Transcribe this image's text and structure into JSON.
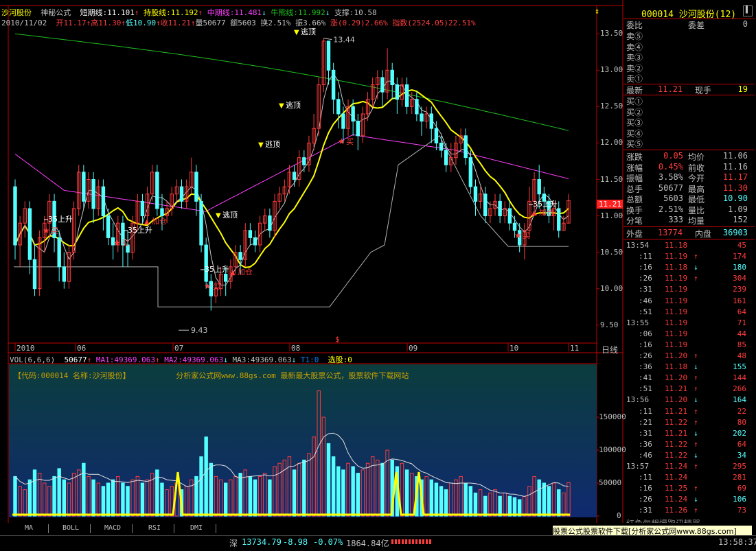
{
  "colors": {
    "up": "#ff3c3c",
    "down": "#54ffff",
    "yellow": "#ffff00",
    "magenta": "#ff40ff",
    "green": "#20c020",
    "white": "#c8c8c8",
    "orange": "#ff8c1a"
  },
  "header": {
    "stock_name": "沙河股份",
    "formula": "神秘公式",
    "short_label": "短期线:11.101",
    "hold_label": "持股线:11.192",
    "mid_label": "中期线:11.481",
    "bull_label": "牛熊线:11.992",
    "support_label": "支撑:10.58",
    "date": "2010/11/02",
    "open": "开11.17",
    "high": "高11.30",
    "low": "低10.90",
    "close": "收11.21",
    "vol": "量50677",
    "amt": "额5603",
    "turnover": "换2.51%",
    "swing": "振3.66%",
    "change": "涨(0.29)2.66%",
    "index": "指数(2524.05)22.51%"
  },
  "price_axis": [
    "13.50",
    "13.00",
    "12.50",
    "12.00",
    "11.50",
    "11.00",
    "10.50",
    "10.00",
    "9.50"
  ],
  "current_price_tag": "11.21",
  "time_axis": [
    "2010",
    "06",
    "07",
    "08",
    "09",
    "10",
    "11"
  ],
  "time_axis_right": "日线",
  "annotations": {
    "max": "13.44",
    "min": "9.43",
    "buy": "买",
    "escape": "逃顶",
    "add": "加仓",
    "up35": "35上升",
    "dollar": "$"
  },
  "vol_header": {
    "title": "VOL(6,6,6)",
    "v": "50677",
    "ma1": "MA1:49369.063",
    "ma2": "MA2:49369.063",
    "ma3": "MA3:49369.063",
    "t1": "T1:0",
    "xuan": "选股:0"
  },
  "vol_banner": {
    "code": "【代码:000014 名称:沙河股份】",
    "site": "分析家公式网www.88gs.com 最新最大股票公式，股票软件下载网站"
  },
  "vol_axis": [
    "150000",
    "100000",
    "50000",
    "0"
  ],
  "chart_data": {
    "type": "candlestick",
    "ylim": [
      9.3,
      13.7
    ],
    "candles": [
      [
        11.4,
        10.6,
        11.5,
        10.4
      ],
      [
        10.6,
        10.9,
        11.0,
        10.3
      ],
      [
        10.9,
        11.1,
        11.2,
        10.7
      ],
      [
        11.1,
        10.4,
        11.2,
        10.2
      ],
      [
        10.4,
        10.0,
        10.6,
        9.9
      ],
      [
        10.0,
        10.7,
        10.8,
        9.9
      ],
      [
        10.7,
        10.9,
        11.0,
        10.5
      ],
      [
        10.9,
        11.2,
        11.3,
        10.7
      ],
      [
        11.2,
        10.7,
        11.3,
        10.5
      ],
      [
        10.7,
        10.3,
        10.8,
        10.1
      ],
      [
        10.3,
        10.1,
        10.5,
        10.0
      ],
      [
        10.1,
        10.5,
        10.6,
        10.0
      ],
      [
        10.5,
        11.1,
        11.2,
        10.4
      ],
      [
        11.1,
        11.6,
        11.7,
        11.0
      ],
      [
        11.6,
        11.2,
        11.7,
        11.1
      ],
      [
        11.2,
        11.5,
        11.6,
        11.1
      ],
      [
        11.5,
        11.1,
        11.6,
        10.9
      ],
      [
        11.1,
        11.4,
        11.5,
        11.0
      ],
      [
        11.4,
        11.0,
        11.5,
        10.8
      ],
      [
        11.0,
        10.7,
        11.1,
        10.6
      ],
      [
        10.7,
        10.6,
        10.9,
        10.4
      ],
      [
        10.6,
        10.9,
        11.0,
        10.5
      ],
      [
        10.9,
        10.6,
        11.0,
        10.3
      ],
      [
        10.6,
        10.5,
        10.8,
        10.3
      ],
      [
        10.5,
        10.9,
        11.0,
        10.4
      ],
      [
        10.9,
        11.2,
        11.3,
        10.8
      ],
      [
        11.2,
        11.0,
        11.3,
        10.9
      ],
      [
        11.0,
        11.3,
        11.4,
        10.9
      ],
      [
        11.3,
        11.6,
        11.7,
        11.2
      ],
      [
        11.6,
        11.1,
        11.7,
        11.0
      ],
      [
        11.1,
        11.0,
        11.3,
        10.8
      ],
      [
        11.0,
        11.1,
        11.2,
        10.9
      ],
      [
        11.1,
        11.3,
        11.4,
        11.0
      ],
      [
        11.3,
        11.4,
        11.5,
        11.2
      ],
      [
        11.4,
        11.2,
        11.5,
        11.1
      ],
      [
        11.2,
        11.4,
        11.5,
        11.1
      ],
      [
        11.4,
        11.6,
        11.8,
        11.3
      ],
      [
        11.6,
        11.2,
        11.7,
        11.0
      ],
      [
        11.2,
        10.6,
        11.3,
        10.5
      ],
      [
        10.6,
        10.1,
        10.7,
        10.0
      ],
      [
        10.1,
        9.9,
        10.2,
        9.7
      ],
      [
        9.9,
        10.0,
        10.1,
        9.8
      ],
      [
        10.0,
        10.2,
        10.3,
        9.9
      ],
      [
        10.2,
        10.1,
        10.3,
        9.9
      ],
      [
        10.1,
        10.3,
        10.4,
        10.0
      ],
      [
        10.3,
        10.5,
        10.6,
        10.2
      ],
      [
        10.5,
        10.4,
        10.6,
        10.2
      ],
      [
        10.4,
        10.8,
        10.9,
        10.3
      ],
      [
        10.8,
        10.7,
        10.9,
        10.6
      ],
      [
        10.7,
        10.6,
        10.8,
        10.5
      ],
      [
        10.6,
        10.9,
        11.0,
        10.5
      ],
      [
        10.9,
        11.0,
        11.1,
        10.8
      ],
      [
        11.0,
        10.8,
        11.1,
        10.7
      ],
      [
        10.8,
        11.2,
        11.3,
        10.7
      ],
      [
        11.2,
        11.3,
        11.4,
        11.1
      ],
      [
        11.3,
        11.4,
        11.5,
        11.2
      ],
      [
        11.4,
        11.6,
        11.7,
        11.3
      ],
      [
        11.6,
        11.5,
        11.7,
        11.4
      ],
      [
        11.5,
        11.8,
        11.9,
        11.4
      ],
      [
        11.8,
        11.7,
        11.9,
        11.6
      ],
      [
        11.7,
        12.0,
        12.1,
        11.6
      ],
      [
        12.0,
        12.2,
        12.4,
        11.9
      ],
      [
        12.2,
        12.8,
        12.9,
        12.1
      ],
      [
        12.8,
        13.4,
        13.44,
        12.7
      ],
      [
        13.4,
        13.0,
        13.4,
        12.8
      ],
      [
        13.0,
        12.6,
        13.1,
        12.4
      ],
      [
        12.6,
        12.4,
        12.7,
        12.2
      ],
      [
        12.4,
        12.2,
        12.5,
        12.0
      ],
      [
        12.2,
        12.5,
        12.6,
        12.1
      ],
      [
        12.5,
        12.3,
        12.6,
        12.1
      ],
      [
        12.3,
        12.1,
        12.4,
        11.9
      ],
      [
        12.1,
        12.4,
        12.5,
        12.0
      ],
      [
        12.4,
        12.6,
        12.7,
        12.3
      ],
      [
        12.6,
        12.8,
        12.9,
        12.5
      ],
      [
        12.8,
        12.9,
        13.0,
        12.6
      ],
      [
        12.9,
        12.7,
        13.0,
        12.5
      ],
      [
        12.7,
        13.0,
        13.3,
        12.6
      ],
      [
        13.0,
        12.8,
        13.1,
        12.6
      ],
      [
        12.8,
        12.6,
        12.9,
        12.4
      ],
      [
        12.6,
        12.8,
        12.9,
        12.5
      ],
      [
        12.8,
        12.5,
        12.9,
        12.4
      ],
      [
        12.5,
        12.6,
        12.7,
        12.4
      ],
      [
        12.6,
        12.4,
        12.7,
        12.3
      ],
      [
        12.4,
        12.3,
        12.5,
        12.1
      ],
      [
        12.3,
        12.4,
        12.5,
        12.2
      ],
      [
        12.4,
        12.2,
        12.5,
        12.0
      ],
      [
        12.2,
        12.0,
        12.3,
        11.9
      ],
      [
        12.0,
        11.9,
        12.1,
        11.8
      ],
      [
        11.9,
        11.7,
        12.0,
        11.6
      ],
      [
        11.7,
        11.8,
        12.0,
        11.6
      ],
      [
        11.8,
        12.0,
        12.1,
        11.7
      ],
      [
        12.0,
        12.1,
        12.2,
        11.9
      ],
      [
        12.1,
        11.8,
        12.2,
        11.7
      ],
      [
        11.8,
        11.4,
        11.9,
        11.3
      ],
      [
        11.4,
        11.2,
        11.5,
        11.0
      ],
      [
        11.2,
        11.3,
        11.4,
        11.1
      ],
      [
        11.3,
        11.0,
        11.4,
        10.9
      ],
      [
        11.0,
        11.1,
        11.2,
        10.9
      ],
      [
        11.1,
        11.2,
        11.3,
        11.0
      ],
      [
        11.2,
        11.0,
        11.3,
        10.9
      ],
      [
        11.0,
        11.1,
        11.2,
        10.9
      ],
      [
        11.1,
        10.9,
        11.2,
        10.8
      ],
      [
        10.9,
        10.8,
        11.0,
        10.7
      ],
      [
        10.8,
        10.6,
        10.9,
        10.5
      ],
      [
        10.6,
        10.8,
        10.9,
        10.4
      ],
      [
        10.8,
        11.2,
        11.4,
        10.7
      ],
      [
        11.2,
        11.5,
        11.6,
        11.0
      ],
      [
        11.5,
        11.3,
        11.7,
        11.1
      ],
      [
        11.3,
        11.2,
        11.4,
        11.0
      ],
      [
        11.2,
        11.0,
        11.3,
        10.9
      ],
      [
        11.0,
        11.1,
        11.2,
        10.8
      ],
      [
        11.1,
        10.8,
        11.2,
        10.7
      ],
      [
        10.8,
        10.9,
        11.0,
        10.8
      ],
      [
        10.9,
        11.21,
        11.3,
        10.9
      ]
    ],
    "volume": [
      60000,
      45000,
      40000,
      55000,
      70000,
      65000,
      50000,
      45000,
      60000,
      72000,
      55000,
      50000,
      65000,
      70000,
      80000,
      60000,
      55000,
      50000,
      45000,
      50000,
      55000,
      60000,
      50000,
      45000,
      55000,
      60000,
      50000,
      55000,
      65000,
      70000,
      50000,
      40000,
      45000,
      50000,
      40000,
      45000,
      55000,
      60000,
      90000,
      120000,
      80000,
      60000,
      55000,
      50000,
      55000,
      60000,
      65000,
      70000,
      60000,
      55000,
      60000,
      65000,
      55000,
      75000,
      80000,
      85000,
      90000,
      70000,
      80000,
      85000,
      95000,
      120000,
      190000,
      150000,
      110000,
      90000,
      75000,
      70000,
      80000,
      75000,
      65000,
      70000,
      80000,
      90000,
      85000,
      80000,
      100000,
      85000,
      75000,
      80000,
      70000,
      65000,
      60000,
      55000,
      60000,
      55000,
      50000,
      45000,
      40000,
      50000,
      55000,
      60000,
      50000,
      45000,
      35000,
      40000,
      30000,
      35000,
      40000,
      30000,
      35000,
      30000,
      28000,
      25000,
      30000,
      45000,
      60000,
      55000,
      50000,
      45000,
      50000,
      40000,
      35000,
      50677
    ]
  },
  "right_panel": {
    "code_title": "000014 沙河股份(12)",
    "wb_label": "委比",
    "wc_label": "委差",
    "wc_value": "0",
    "sell": [
      "卖⑤",
      "卖④",
      "卖③",
      "卖②",
      "卖①"
    ],
    "buy": [
      "买①",
      "买②",
      "买③",
      "买④",
      "买⑤"
    ],
    "last_label": "最新",
    "last_value": "11.21",
    "now_hand_label": "现手",
    "now_hand_value": "19",
    "stats": [
      [
        "涨跌",
        "0.05",
        "均价",
        "11.06"
      ],
      [
        "涨幅",
        "0.45%",
        "前收",
        "11.16"
      ],
      [
        "振幅",
        "3.58%",
        "今开",
        "11.17"
      ],
      [
        "总手",
        "50677",
        "最高",
        "11.30"
      ],
      [
        "总额",
        "5603",
        "最低",
        "10.90"
      ],
      [
        "换手",
        "2.51%",
        "量比",
        "1.09"
      ],
      [
        "分笔",
        "333",
        "均量",
        "152"
      ]
    ],
    "outer_label": "外盘",
    "outer_value": "13774",
    "inner_label": "内盘",
    "inner_value": "36903",
    "ticks": [
      [
        "13:54",
        "11.18",
        "",
        "45"
      ],
      [
        ":11",
        "11.19",
        "↑",
        "174"
      ],
      [
        ":16",
        "11.18",
        "↓",
        "180"
      ],
      [
        ":26",
        "11.19",
        "↑",
        "304"
      ],
      [
        ":31",
        "11.19",
        "",
        "239"
      ],
      [
        ":46",
        "11.19",
        "",
        "161"
      ],
      [
        ":51",
        "11.19",
        "",
        "64"
      ],
      [
        "13:55",
        "11.19",
        "",
        "71"
      ],
      [
        ":06",
        "11.19",
        "",
        "44"
      ],
      [
        ":16",
        "11.19",
        "",
        "85"
      ],
      [
        ":26",
        "11.20",
        "↑",
        "48"
      ],
      [
        ":36",
        "11.18",
        "↓",
        "155"
      ],
      [
        ":41",
        "11.20",
        "↑",
        "144"
      ],
      [
        ":51",
        "11.21",
        "↑",
        "266"
      ],
      [
        "13:56",
        "11.20",
        "↓",
        "164"
      ],
      [
        ":11",
        "11.21",
        "↑",
        "22"
      ],
      [
        ":21",
        "11.22",
        "↑",
        "80"
      ],
      [
        ":31",
        "11.21",
        "↓",
        "202"
      ],
      [
        ":36",
        "11.22",
        "↑",
        "64"
      ],
      [
        ":46",
        "11.22",
        "↓",
        "34"
      ],
      [
        "13:57",
        "11.24",
        "↑",
        "295"
      ],
      [
        ":11",
        "11.24",
        "",
        "281"
      ],
      [
        ":16",
        "11.25",
        "↑",
        "69"
      ],
      [
        ":26",
        "11.24",
        "↓",
        "106"
      ],
      [
        ":31",
        "11.26",
        "↑",
        "73"
      ]
    ],
    "scroll_text": "红色勿想慢跑讯精骂"
  },
  "tabs": [
    "MA",
    "BOLL",
    "MACD",
    "RSI",
    "DMI"
  ],
  "statusbar": {
    "index_name": "深",
    "index_value": "13734.79",
    "index_change": "-8.98",
    "index_pct": "-0.07%",
    "index_amount": "1864.84亿",
    "clock": "13:58:37"
  },
  "ad_text": "股票公式股票软件下载[分析家公式网www.88gs.com]"
}
